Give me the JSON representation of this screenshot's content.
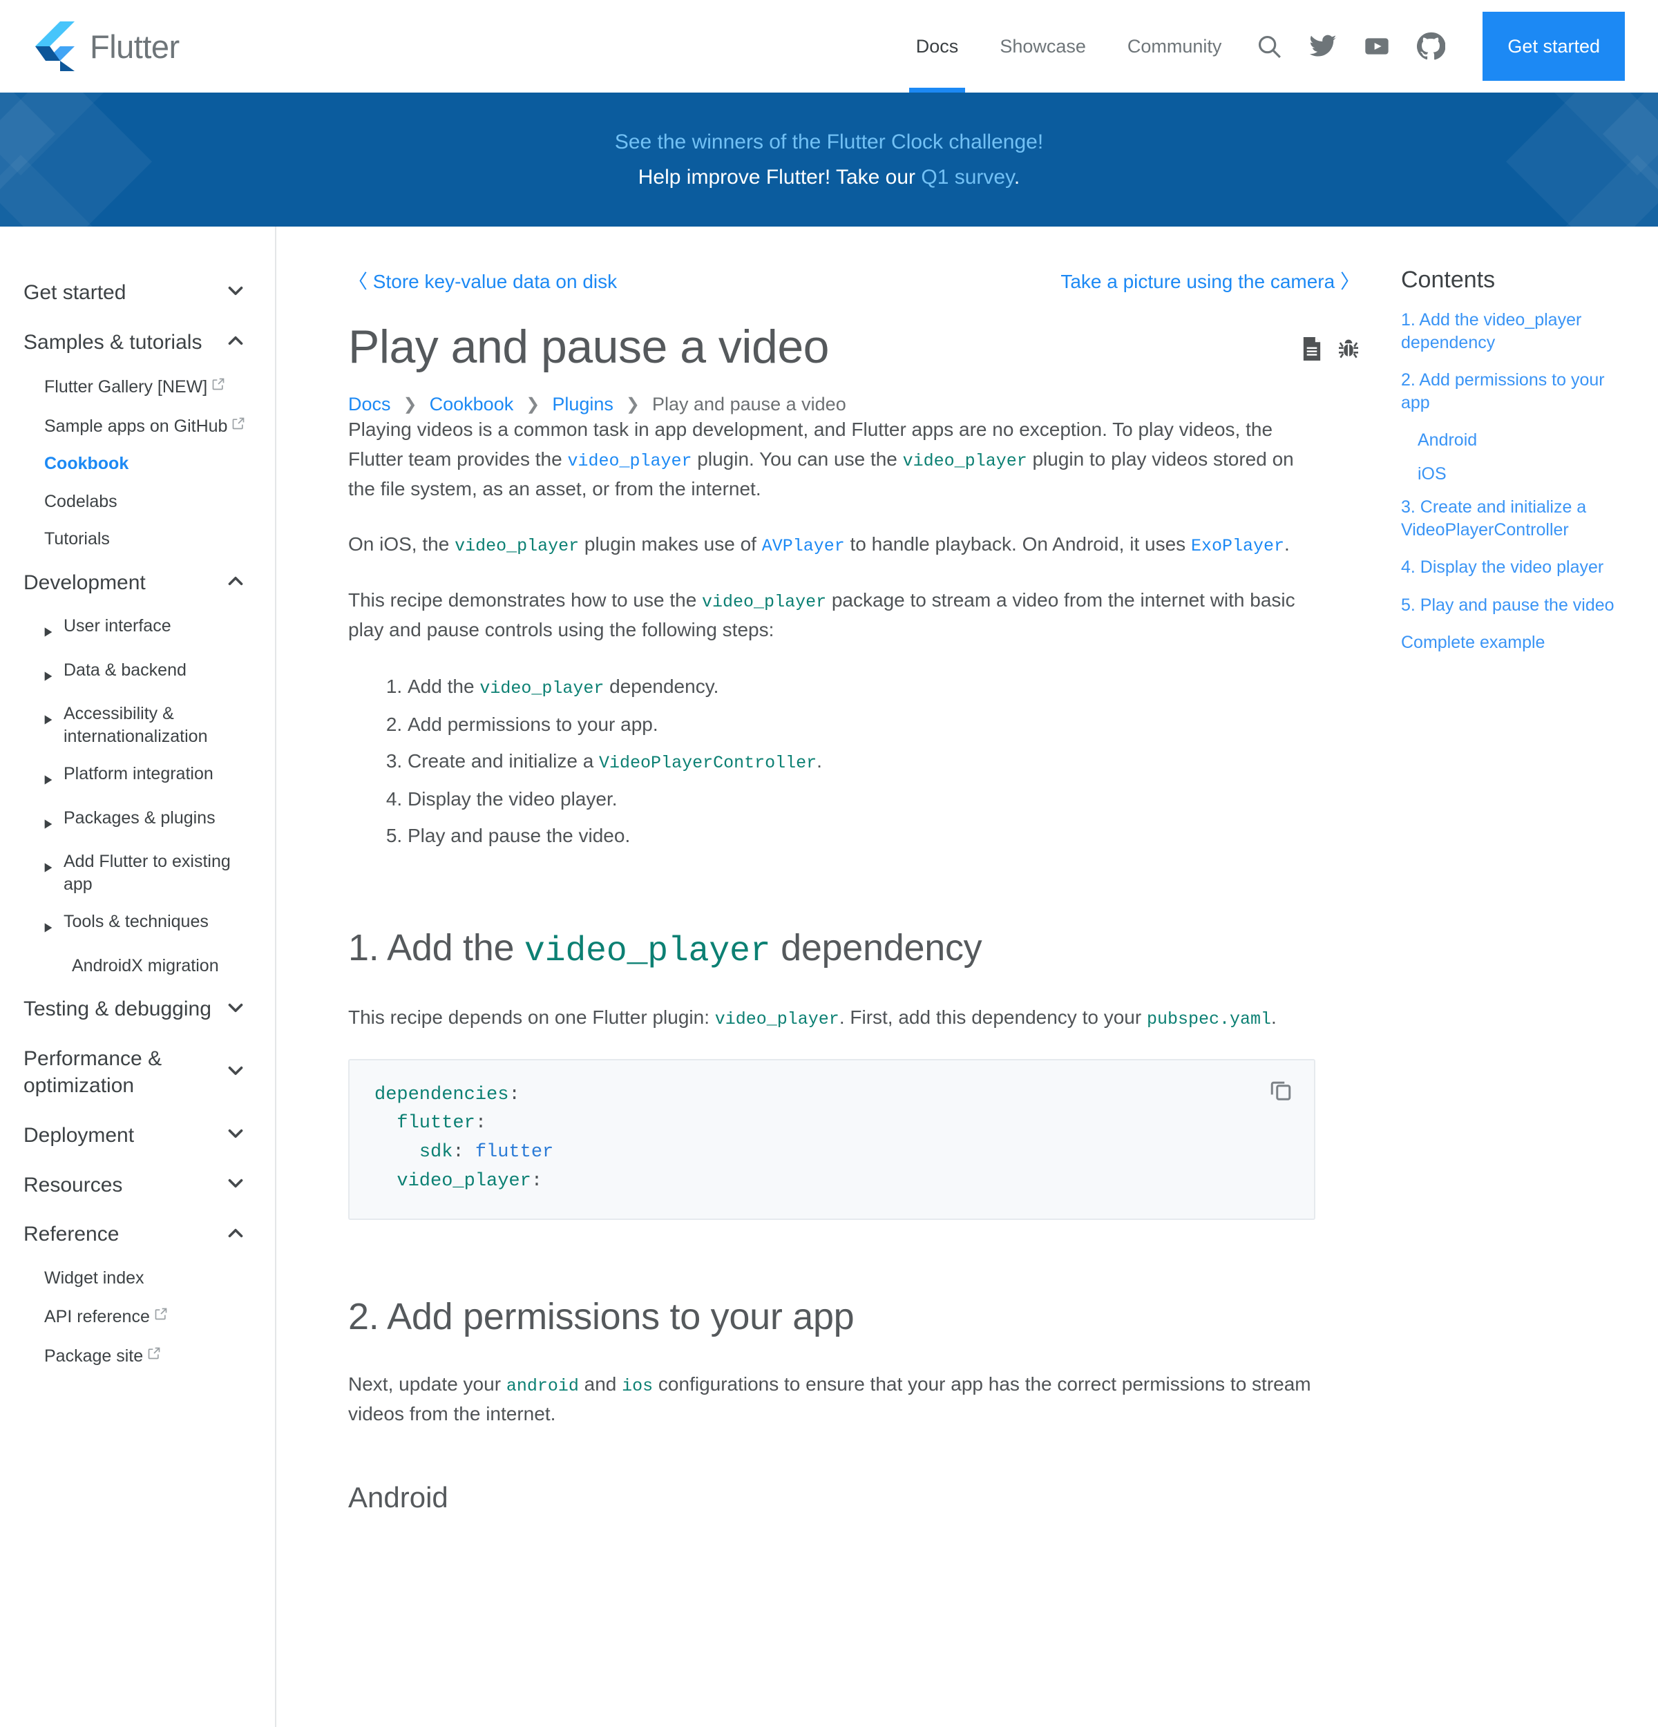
{
  "brand": {
    "name": "Flutter"
  },
  "nav": {
    "links": [
      {
        "label": "Docs",
        "active": true
      },
      {
        "label": "Showcase",
        "active": false
      },
      {
        "label": "Community",
        "active": false
      }
    ],
    "icons": [
      "search-icon",
      "twitter-icon",
      "youtube-icon",
      "github-icon"
    ],
    "cta": "Get started"
  },
  "banner": {
    "line1_link": "See the winners of the Flutter Clock challenge!",
    "line2_prefix": "Help improve Flutter! Take our ",
    "line2_link": "Q1 survey",
    "line2_suffix": ".",
    "bg_color": "#0b5c9e"
  },
  "sidebar": {
    "groups": [
      {
        "label": "Get started",
        "state": "collapsed",
        "children": []
      },
      {
        "label": "Samples & tutorials",
        "state": "expanded",
        "children": [
          {
            "label": "Flutter Gallery [NEW]",
            "external": true,
            "active": false
          },
          {
            "label": "Sample apps on GitHub",
            "external": true,
            "active": false
          },
          {
            "label": "Cookbook",
            "external": false,
            "active": true
          },
          {
            "label": "Codelabs",
            "external": false,
            "active": false
          },
          {
            "label": "Tutorials",
            "external": false,
            "active": false
          }
        ]
      },
      {
        "label": "Development",
        "state": "expanded",
        "subitems": [
          {
            "label": "User interface",
            "arrow": true
          },
          {
            "label": "Data & backend",
            "arrow": true
          },
          {
            "label": "Accessibility & internationalization",
            "arrow": true
          },
          {
            "label": "Platform integration",
            "arrow": true
          },
          {
            "label": "Packages & plugins",
            "arrow": true
          },
          {
            "label": "Add Flutter to existing app",
            "arrow": true
          },
          {
            "label": "Tools & techniques",
            "arrow": true
          },
          {
            "label": "AndroidX migration",
            "arrow": false
          }
        ]
      },
      {
        "label": "Testing & debugging",
        "state": "collapsed",
        "children": []
      },
      {
        "label": "Performance & optimization",
        "state": "collapsed",
        "children": []
      },
      {
        "label": "Deployment",
        "state": "collapsed",
        "children": []
      },
      {
        "label": "Resources",
        "state": "collapsed",
        "children": []
      },
      {
        "label": "Reference",
        "state": "expanded",
        "children": [
          {
            "label": "Widget index",
            "external": false,
            "active": false
          },
          {
            "label": "API reference",
            "external": true,
            "active": false
          },
          {
            "label": "Package site",
            "external": true,
            "active": false
          }
        ]
      }
    ]
  },
  "pager": {
    "prev_chevron": "〈",
    "prev": "Store key-value data on disk",
    "next": "Take a picture using the camera",
    "next_chevron": "〉"
  },
  "article": {
    "title": "Play and pause a video",
    "actions": [
      "document-icon",
      "bug-icon"
    ],
    "breadcrumb": [
      {
        "label": "Docs",
        "link": true
      },
      {
        "label": "Cookbook",
        "link": true
      },
      {
        "label": "Plugins",
        "link": true
      },
      {
        "label": "Play and pause a video",
        "link": false
      }
    ],
    "p1_a": "Playing videos is a common task in app development, and Flutter apps are no exception. To play videos, the Flutter team provides the ",
    "p1_code1": "video_player",
    "p1_b": " plugin. You can use the ",
    "p1_code2": "video_player",
    "p1_c": " plugin to play videos stored on the file system, as an asset, or from the internet.",
    "p2_a": "On iOS, the ",
    "p2_code1": "video_player",
    "p2_b": " plugin makes use of ",
    "p2_code2": "AVPlayer",
    "p2_c": " to handle playback. On Android, it uses ",
    "p2_code3": "ExoPlayer",
    "p2_d": ".",
    "p3_a": "This recipe demonstrates how to use the ",
    "p3_code1": "video_player",
    "p3_b": " package to stream a video from the internet with basic play and pause controls using the following steps:",
    "steps": [
      {
        "a": "Add the ",
        "code": "video_player",
        "b": " dependency."
      },
      {
        "a": "Add permissions to your app.",
        "code": "",
        "b": ""
      },
      {
        "a": "Create and initialize a ",
        "code": "VideoPlayerController",
        "b": "."
      },
      {
        "a": "Display the video player.",
        "code": "",
        "b": ""
      },
      {
        "a": "Play and pause the video.",
        "code": "",
        "b": ""
      }
    ],
    "s1_heading_a": "1. Add the ",
    "s1_heading_code": "video_player",
    "s1_heading_b": " dependency",
    "s1_p_a": "This recipe depends on one Flutter plugin: ",
    "s1_p_code1": "video_player",
    "s1_p_b": ". First, add this dependency to your ",
    "s1_p_code2": "pubspec.yaml",
    "s1_p_c": ".",
    "code_lines": [
      {
        "k": "dependencies",
        "p": ":",
        "v": "",
        "indent": 0
      },
      {
        "k": "flutter",
        "p": ":",
        "v": "",
        "indent": 1
      },
      {
        "k": "sdk",
        "p": ": ",
        "v": "flutter",
        "indent": 2
      },
      {
        "k": "video_player",
        "p": ":",
        "v": "",
        "indent": 1
      }
    ],
    "copy_icon": "copy-icon",
    "s2_heading": "2. Add permissions to your app",
    "s2_p_a": "Next, update your ",
    "s2_p_code1": "android",
    "s2_p_b": " and ",
    "s2_p_code2": "ios",
    "s2_p_c": " configurations to ensure that your app has the correct permissions to stream videos from the internet.",
    "s2_sub_heading": "Android"
  },
  "toc": {
    "title": "Contents",
    "items": [
      {
        "label": "1. Add the video_player dependency",
        "level": 1
      },
      {
        "label": "2. Add permissions to your app",
        "level": 1
      },
      {
        "label": "Android",
        "level": 2
      },
      {
        "label": "iOS",
        "level": 2
      },
      {
        "label": "3. Create and initialize a VideoPlayerController",
        "level": 1
      },
      {
        "label": "4. Display the video player",
        "level": 1
      },
      {
        "label": "5. Play and pause the video",
        "level": 1
      },
      {
        "label": "Complete example",
        "level": 1
      }
    ]
  },
  "colors": {
    "accent_blue": "#1c89f4",
    "banner_blue": "#0b5c9e",
    "code_teal": "#0c8073",
    "link_blue": "#3a94f5"
  }
}
